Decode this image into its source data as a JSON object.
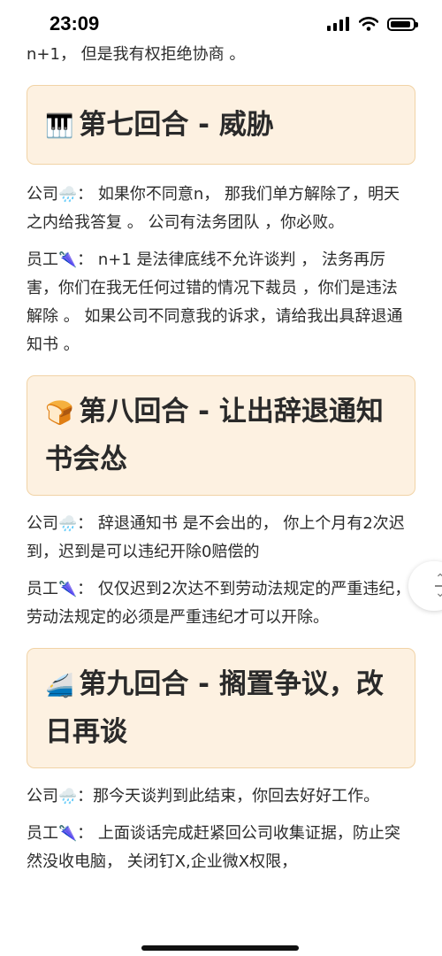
{
  "status_bar": {
    "time": "23:09"
  },
  "article": {
    "intro_line": "n+1， 但是我有权拒绝协商 。",
    "round7": {
      "icon": "🎹",
      "title": "第七回合 - 威胁",
      "company_speaker": "公司",
      "company_icon": "🌧️",
      "company_text": "： 如果你不同意n， 那我们单方解除了，明天之内给我答复 。 公司有法务团队 ，你必败。",
      "employee_speaker": "员工",
      "employee_icon": "🌂",
      "employee_text": "： n+1 是法律底线不允许谈判 ， 法务再厉害，你们在我无任何过错的情况下裁员 ，你们是违法解除 。 如果公司不同意我的诉求，请给我出具辞退通知书 。"
    },
    "round8": {
      "icon": "🍞",
      "title": "第八回合 - 让出辞退通知书会怂",
      "company_speaker": "公司",
      "company_icon": "🌧️",
      "company_text": "： 辞退通知书 是不会出的， 你上个月有2次迟到，迟到是可以违纪开除0赔偿的",
      "employee_speaker": "员工",
      "employee_icon": "🌂",
      "employee_text": "： 仅仅迟到2次达不到劳动法规定的严重违纪， 劳动法规定的必须是严重违纪才可以开除。"
    },
    "round9": {
      "icon": "🚄",
      "title": "第九回合 - 搁置争议，改日再谈",
      "company_speaker": "公司",
      "company_icon": "🌧️",
      "company_text": "：那今天谈判到此结束，你回去好好工作。",
      "employee_speaker": "员工",
      "employee_icon": "🌂",
      "employee_text": "： 上面谈话完成赶紧回公司收集证据，防止突然没收电脑， 关闭钉X,企业微X权限，"
    }
  },
  "colors": {
    "card_bg": "#fdf1e1",
    "card_border": "#f1d3a6"
  },
  "icons": {
    "signal": "cellular-signal-icon",
    "wifi": "wifi-icon",
    "battery": "battery-icon",
    "scroll": "scroll-handle-icon"
  },
  "battery_level_percent": 90
}
